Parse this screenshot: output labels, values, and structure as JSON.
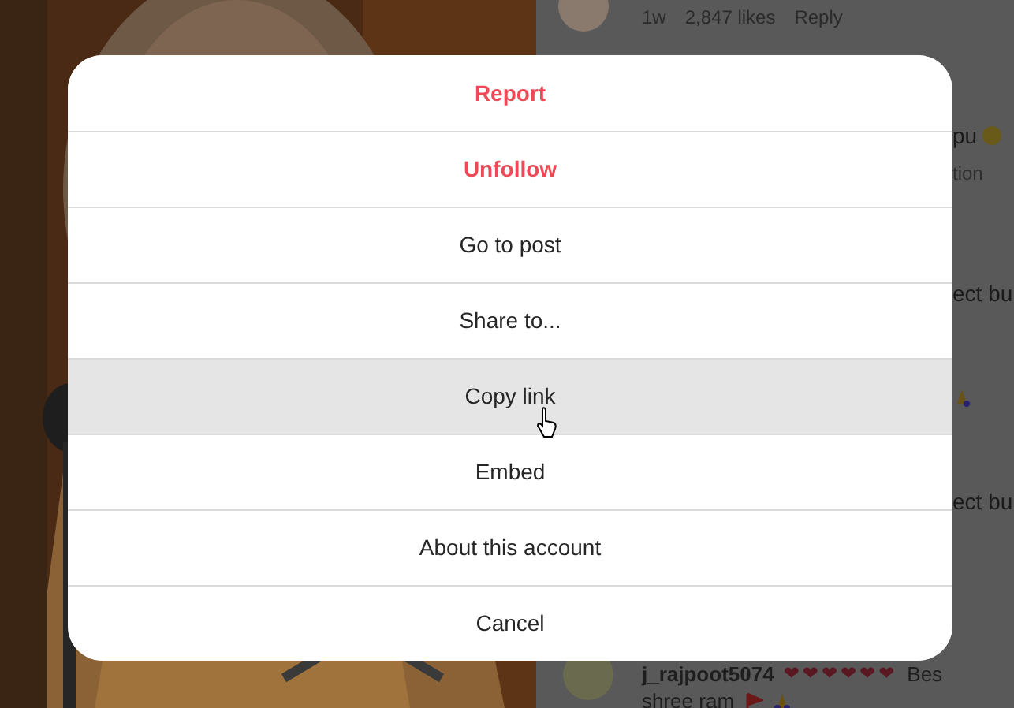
{
  "comments_top": {
    "age": "1w",
    "likes": "2,847 likes",
    "reply": "Reply"
  },
  "comment_fragments": [
    {
      "kind": "text_emoji",
      "text": "pu"
    },
    {
      "kind": "meta",
      "text": "tion"
    },
    {
      "kind": "text",
      "text": "ect bu"
    },
    {
      "kind": "emoji"
    },
    {
      "kind": "text",
      "text": "ect bu"
    }
  ],
  "comment_bottom": {
    "username": "j_rajpoot5074",
    "hearts": "❤❤❤❤❤❤",
    "text_1": "Bes",
    "text_2": "shree ram"
  },
  "menu": [
    {
      "label": "Report",
      "kind": "danger",
      "selected": false
    },
    {
      "label": "Unfollow",
      "kind": "danger",
      "selected": false
    },
    {
      "label": "Go to post",
      "kind": "normal",
      "selected": false
    },
    {
      "label": "Share to...",
      "kind": "normal",
      "selected": false
    },
    {
      "label": "Copy link",
      "kind": "normal",
      "selected": true
    },
    {
      "label": "Embed",
      "kind": "normal",
      "selected": false
    },
    {
      "label": "About this account",
      "kind": "normal",
      "selected": false
    },
    {
      "label": "Cancel",
      "kind": "normal",
      "selected": false
    }
  ]
}
